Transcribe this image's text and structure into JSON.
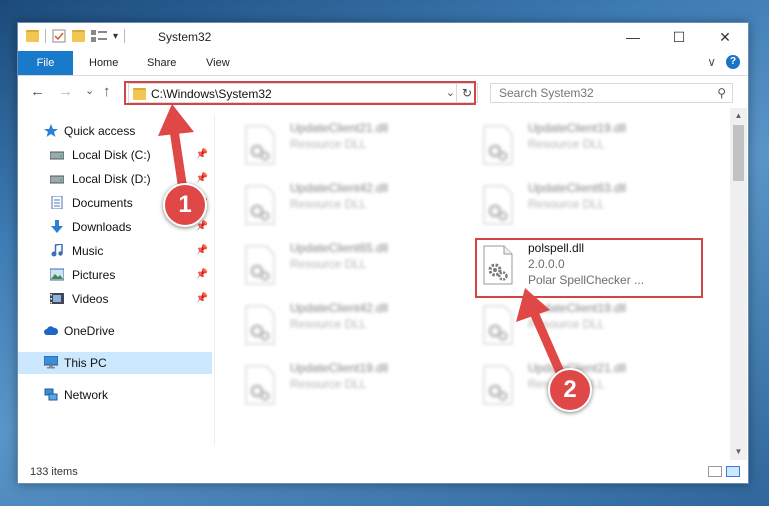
{
  "window": {
    "title": "System32",
    "controls": {
      "minimize": "—",
      "maximize": "☐",
      "close": "✕"
    }
  },
  "ribbon": {
    "tabs": [
      {
        "label": "File"
      },
      {
        "label": "Home"
      },
      {
        "label": "Share"
      },
      {
        "label": "View"
      }
    ],
    "expand_glyph": "∨",
    "help_glyph": "?"
  },
  "navigation": {
    "back_glyph": "←",
    "forward_glyph": "→",
    "recent_glyph": "⌄",
    "up_glyph": "↑",
    "address": "C:\\Windows\\System32",
    "address_dropdown_glyph": "⌄",
    "refresh_glyph": "↻",
    "search_placeholder": "Search System32",
    "search_glyph": "⚲"
  },
  "sidebar": {
    "items": [
      {
        "label": "Quick access",
        "icon": "star-icon",
        "pinned": false
      },
      {
        "label": "Local Disk (C:)",
        "icon": "drive-icon",
        "pinned": true
      },
      {
        "label": "Local Disk (D:)",
        "icon": "drive-icon",
        "pinned": true
      },
      {
        "label": "Documents",
        "icon": "document-icon",
        "pinned": true
      },
      {
        "label": "Downloads",
        "icon": "download-icon",
        "pinned": true
      },
      {
        "label": "Music",
        "icon": "music-icon",
        "pinned": true
      },
      {
        "label": "Pictures",
        "icon": "picture-icon",
        "pinned": true
      },
      {
        "label": "Videos",
        "icon": "video-icon",
        "pinned": true
      },
      {
        "label": "OneDrive",
        "icon": "cloud-icon",
        "pinned": false
      },
      {
        "label": "This PC",
        "icon": "computer-icon",
        "pinned": false,
        "selected": true
      },
      {
        "label": "Network",
        "icon": "network-icon",
        "pinned": false
      }
    ],
    "pin_glyph": "📌"
  },
  "files": [
    {
      "name": "UpdateClient21.dll",
      "line2": "Resource DLL",
      "blurred": true
    },
    {
      "name": "UpdateClient19.dll",
      "line2": "Resource DLL",
      "blurred": true
    },
    {
      "name": "UpdateClient42.dll",
      "line2": "Resource DLL",
      "blurred": true
    },
    {
      "name": "UpdateClient63.dll",
      "line2": "Resource DLL",
      "blurred": true
    },
    {
      "name": "UpdateClient65.dll",
      "line2": "Resource DLL",
      "blurred": true
    },
    {
      "name": "polspell.dll",
      "line2": "2.0.0.0",
      "line3": "Polar SpellChecker ...",
      "blurred": false
    },
    {
      "name": "UpdateClient42.dll",
      "line2": "Resource DLL",
      "blurred": true
    },
    {
      "name": "UpdateClient19.dll",
      "line2": "Resource DLL",
      "blurred": true
    },
    {
      "name": "UpdateClient19.dll",
      "line2": "Resource DLL",
      "blurred": true
    },
    {
      "name": "UpdateClient21.dll",
      "line2": "Resource DLL",
      "blurred": true
    }
  ],
  "status": {
    "item_count": "133 items"
  },
  "annotations": {
    "step1": "1",
    "step2": "2",
    "color": "#e04848"
  },
  "colors": {
    "file_tab": "#1979ca",
    "selection": "#cce8ff",
    "highlight_box": "#d04545"
  }
}
